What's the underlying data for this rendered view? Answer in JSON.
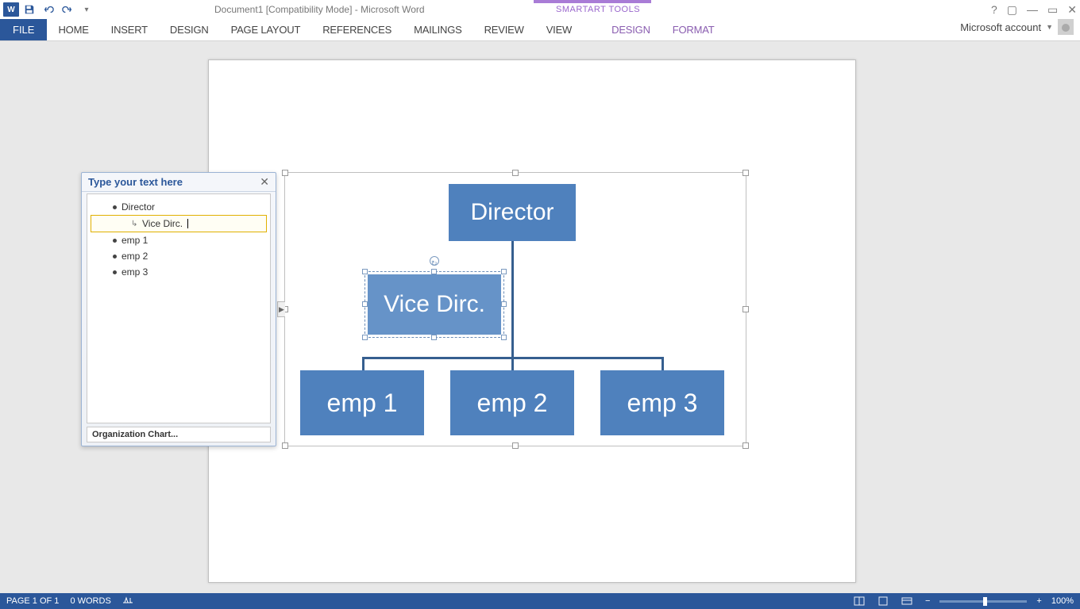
{
  "title": "Document1 [Compatibility Mode] - Microsoft Word",
  "contextual_label": "SMARTART TOOLS",
  "tabs": {
    "file": "FILE",
    "home": "HOME",
    "insert": "INSERT",
    "design": "DESIGN",
    "page_layout": "PAGE LAYOUT",
    "references": "REFERENCES",
    "mailings": "MAILINGS",
    "review": "REVIEW",
    "view": "VIEW",
    "sa_design": "DESIGN",
    "sa_format": "FORMAT"
  },
  "account": {
    "label": "Microsoft account"
  },
  "textpane": {
    "title": "Type your text here",
    "items": [
      {
        "level": 1,
        "text": "Director"
      },
      {
        "level": 2,
        "text": "Vice Dirc.",
        "selected": true,
        "editing": true
      },
      {
        "level": 1,
        "text": "emp 1"
      },
      {
        "level": 1,
        "text": "emp 2"
      },
      {
        "level": 1,
        "text": "emp 3"
      }
    ],
    "footer": "Organization Chart..."
  },
  "org": {
    "director": "Director",
    "vice": "Vice Dirc.",
    "emp1": "emp 1",
    "emp2": "emp 2",
    "emp3": "emp 3"
  },
  "statusbar": {
    "page": "PAGE 1 OF 1",
    "words": "0 WORDS",
    "zoom": "100%"
  },
  "chart_data": {
    "type": "hierarchy",
    "title": "Organization Chart",
    "nodes": [
      {
        "id": "director",
        "label": "Director",
        "parent": null
      },
      {
        "id": "vice",
        "label": "Vice Dirc.",
        "parent": "director",
        "assistant": true
      },
      {
        "id": "emp1",
        "label": "emp 1",
        "parent": "director"
      },
      {
        "id": "emp2",
        "label": "emp 2",
        "parent": "director"
      },
      {
        "id": "emp3",
        "label": "emp 3",
        "parent": "director"
      }
    ]
  }
}
